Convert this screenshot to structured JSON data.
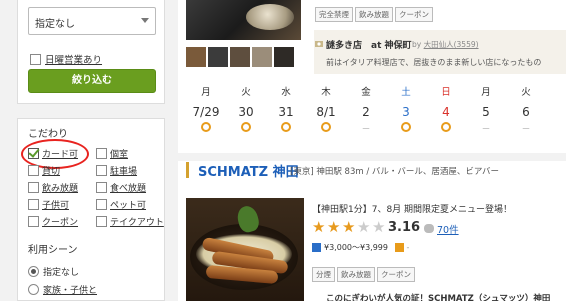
{
  "sidebar": {
    "select": {
      "value": "指定なし"
    },
    "holiday_label": "日曜営業あり",
    "filter_button": "絞り込む",
    "kodawari_title": "こだわり",
    "kodawari": [
      {
        "label": "カード可",
        "checked": true
      },
      {
        "label": "個室",
        "checked": false
      },
      {
        "label": "貸切",
        "checked": false
      },
      {
        "label": "駐車場",
        "checked": false
      },
      {
        "label": "飲み放題",
        "checked": false
      },
      {
        "label": "食べ放題",
        "checked": false
      },
      {
        "label": "子供可",
        "checked": false
      },
      {
        "label": "ペット可",
        "checked": false
      },
      {
        "label": "クーポン",
        "checked": false
      },
      {
        "label": "テイクアウト",
        "checked": false
      }
    ],
    "scene_title": "利用シーン",
    "scene": [
      {
        "label": "指定なし",
        "selected": true
      },
      {
        "label": "家族・子供と",
        "selected": false
      }
    ]
  },
  "card1": {
    "tags": [
      "完全禁煙",
      "飲み放題",
      "クーポン"
    ],
    "review": {
      "title": "謎多き店　at 神保町",
      "by_prefix": "by",
      "author": "大田仙人(3559)",
      "text": "前はイタリア料理店で、居抜きのまま新しい店になったもの"
    },
    "calendar": [
      {
        "weekday": "月",
        "date": "7/29",
        "mark": "○",
        "kind": "weekday"
      },
      {
        "weekday": "火",
        "date": "30",
        "mark": "○",
        "kind": "weekday"
      },
      {
        "weekday": "水",
        "date": "31",
        "mark": "○",
        "kind": "weekday"
      },
      {
        "weekday": "木",
        "date": "8/1",
        "mark": "○",
        "kind": "weekday"
      },
      {
        "weekday": "金",
        "date": "2",
        "mark": "－",
        "kind": "weekday"
      },
      {
        "weekday": "土",
        "date": "3",
        "mark": "○",
        "kind": "sat"
      },
      {
        "weekday": "日",
        "date": "4",
        "mark": "○",
        "kind": "sun"
      },
      {
        "weekday": "月",
        "date": "5",
        "mark": "－",
        "kind": "weekday"
      },
      {
        "weekday": "火",
        "date": "6",
        "mark": "－",
        "kind": "weekday"
      }
    ]
  },
  "card2": {
    "name": "SCHMATZ 神田",
    "meta": "[東京] 神田駅 83m / バル・バール、居酒屋、ビアバー",
    "promo": "【神田駅1分】7、8月 期間限定夏メニュー登場！",
    "rating": {
      "score": "3.16",
      "stars": 3,
      "reviews": "70件"
    },
    "price": "¥3,000～¥3,999",
    "tags": [
      "分煙",
      "飲み放題",
      "クーポン"
    ],
    "teaser": "このにぎわいが人気の証！SCHMATZ（シュマッツ）神田"
  },
  "colors": {
    "accent_green": "#6a9e1f",
    "link_blue": "#1d5fb8",
    "star_orange": "#e79a1e",
    "highlight_red": "#e8231f"
  }
}
